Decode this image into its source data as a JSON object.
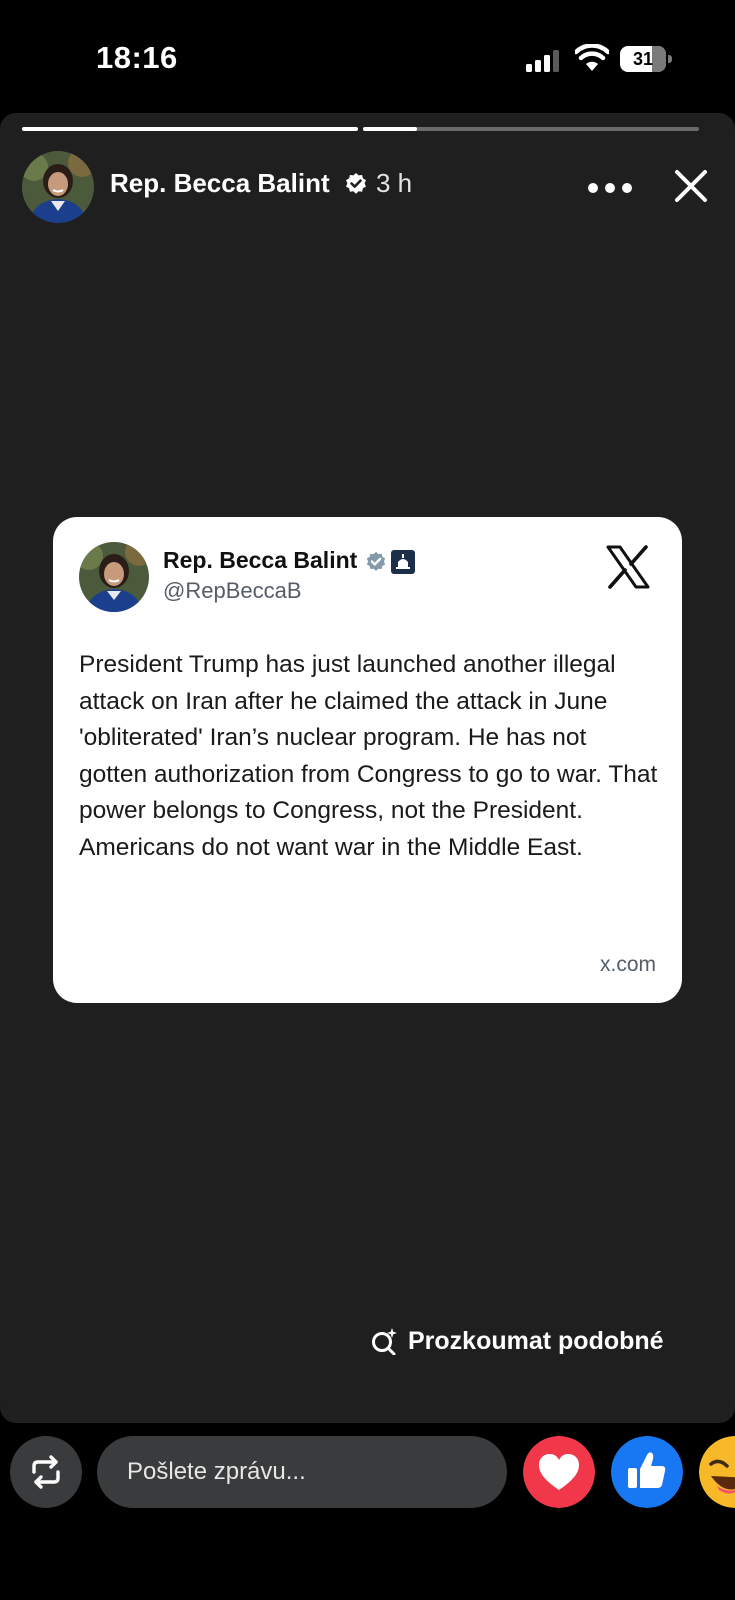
{
  "status_bar": {
    "time": "18:16",
    "battery_level": "31"
  },
  "story": {
    "author_name": "Rep. Becca Balint",
    "time_ago": "3 h",
    "progress_segments": [
      1.0,
      0.16
    ],
    "explore_label": "Prozkoumat podobné"
  },
  "post": {
    "name": "Rep. Becca Balint",
    "handle": "@RepBeccaB",
    "text": "President Trump has just launched another illegal attack on Iran after he claimed the attack in June 'obliterated' Iran’s nuclear program. He has not gotten authorization from Congress to go to war. That power belongs to Congress, not the President. Americans do not want war in the Middle East.",
    "source": "x.com"
  },
  "bottom_bar": {
    "message_placeholder": "Pošlete zprávu..."
  },
  "colors": {
    "story_bg": "#1f1f1f",
    "heart_red": "#f0384a",
    "like_blue": "#1877f2",
    "verified_blue": "#1d9bf0"
  },
  "icons": [
    "share-icon",
    "heart-icon",
    "like-icon",
    "laugh-emoji-icon",
    "x-logo-icon",
    "verified-icon",
    "close-icon",
    "more-icon",
    "explore-sparkle-icon"
  ]
}
